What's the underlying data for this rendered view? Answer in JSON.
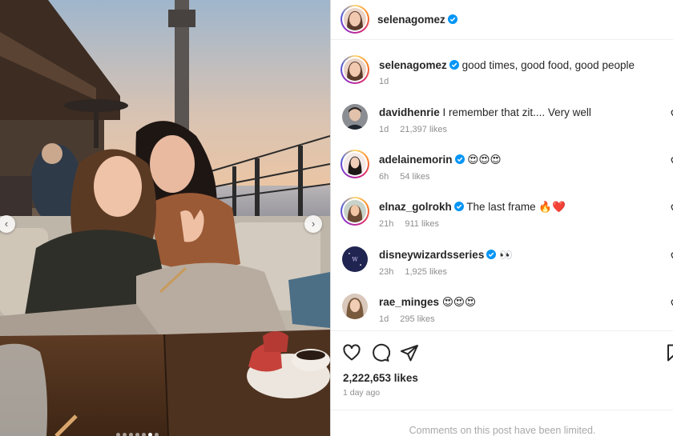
{
  "post": {
    "author": "selenagomez",
    "caption": "good times, good food, good people",
    "caption_age": "1d",
    "likes": "2,222,653 likes",
    "posted": "1 day ago",
    "comments_notice": "Comments on this post have been limited."
  },
  "comments": [
    {
      "user": "davidhenrie",
      "verified": false,
      "text": "I remember that zit.... Very well",
      "age": "1d",
      "likes": "21,397 likes"
    },
    {
      "user": "adelainemorin",
      "verified": true,
      "text": "😍😍😍",
      "age": "6h",
      "likes": "54 likes"
    },
    {
      "user": "elnaz_golrokh",
      "verified": true,
      "text": "The last frame 🔥❤️",
      "age": "21h",
      "likes": "911 likes"
    },
    {
      "user": "disneywizardsseries",
      "verified": true,
      "text": "👀",
      "age": "23h",
      "likes": "1,925 likes"
    },
    {
      "user": "rae_minges",
      "verified": false,
      "text": "😍😍😍",
      "age": "1d",
      "likes": "295 likes"
    }
  ],
  "carousel": {
    "slide_count": 7,
    "active_index": 5
  },
  "icons": {
    "verified": "verified-badge-icon",
    "like": "heart-icon",
    "comment": "comment-bubble-icon",
    "share": "paper-plane-icon",
    "save": "bookmark-icon",
    "prev": "chevron-left-icon",
    "next": "chevron-right-icon"
  },
  "colors": {
    "verified": "#0095f6",
    "text": "#262626",
    "muted": "#8e8e8e"
  }
}
